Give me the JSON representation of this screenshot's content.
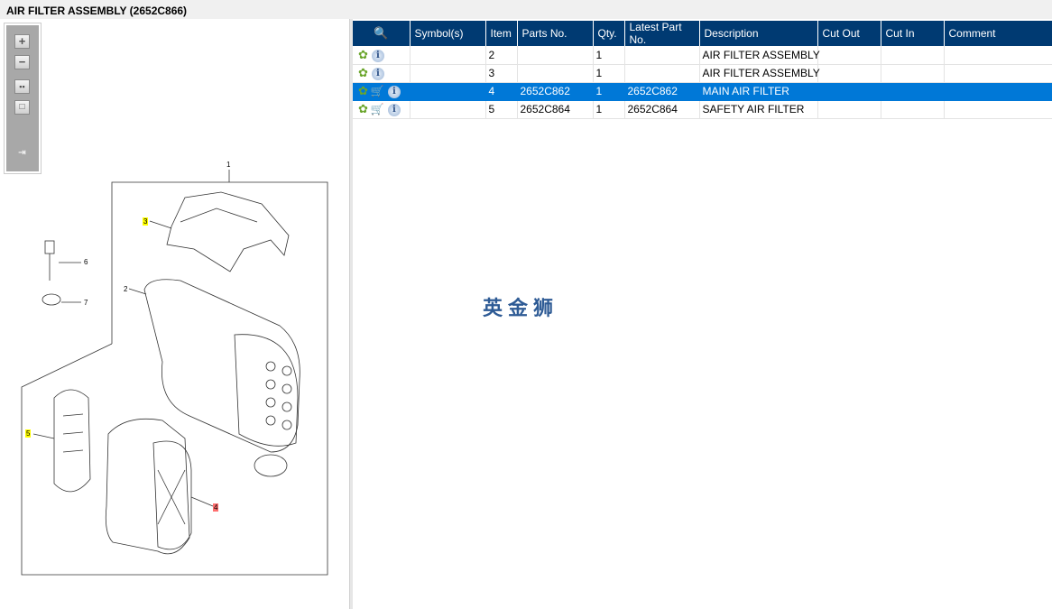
{
  "title": "AIR FILTER ASSEMBLY (2652C866)",
  "toolbar": {
    "zoom_in": "+",
    "zoom_out": "−"
  },
  "table": {
    "headers": [
      "Symbol(s)",
      "Item",
      "Parts No.",
      "Qty.",
      "Latest Part No.",
      "Description",
      "Cut Out",
      "Cut In",
      "Comment"
    ],
    "rows": [
      {
        "cart": false,
        "symbols": "",
        "item": "2",
        "parts_no": "",
        "qty": "1",
        "latest": "",
        "description": "AIR FILTER ASSEMBLY",
        "cut_out": "",
        "cut_in": "",
        "comment": ""
      },
      {
        "cart": false,
        "symbols": "",
        "item": "3",
        "parts_no": "",
        "qty": "1",
        "latest": "",
        "description": "AIR FILTER ASSEMBLY",
        "cut_out": "",
        "cut_in": "",
        "comment": ""
      },
      {
        "cart": true,
        "symbols": "",
        "item": "4",
        "parts_no": "2652C862",
        "qty": "1",
        "latest": "2652C862",
        "description": "MAIN AIR FILTER",
        "cut_out": "",
        "cut_in": "",
        "comment": "",
        "selected": true
      },
      {
        "cart": true,
        "symbols": "",
        "item": "5",
        "parts_no": "2652C864",
        "qty": "1",
        "latest": "2652C864",
        "description": "SAFETY AIR FILTER",
        "cut_out": "",
        "cut_in": "",
        "comment": ""
      }
    ]
  },
  "diagram": {
    "callouts": [
      "1",
      "2",
      "3",
      "4",
      "5",
      "6",
      "7"
    ]
  },
  "watermark": "英金狮"
}
